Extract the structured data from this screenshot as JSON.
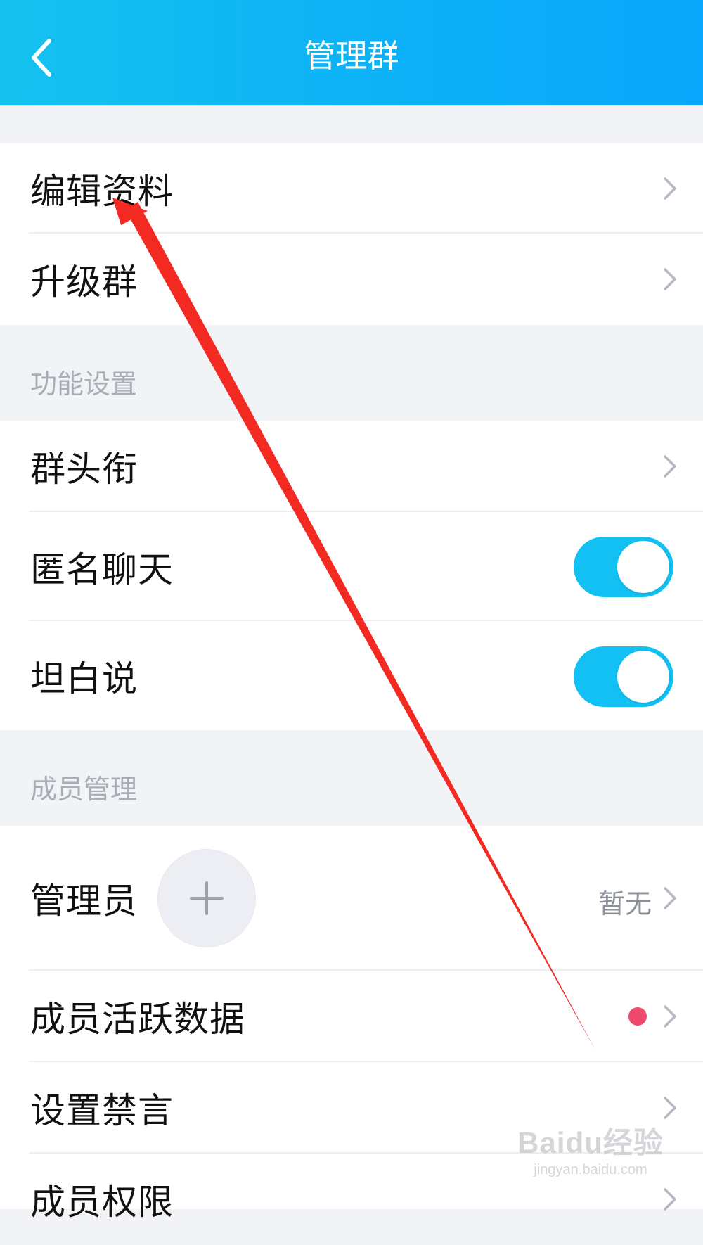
{
  "header": {
    "title": "管理群",
    "back_icon": "back-chevron-icon"
  },
  "group_top": {
    "items": [
      {
        "label": "编辑资料"
      },
      {
        "label": "升级群"
      }
    ]
  },
  "section_function": {
    "title": "功能设置",
    "items": [
      {
        "label": "群头衔"
      },
      {
        "label": "匿名聊天",
        "toggle": true
      },
      {
        "label": "坦白说",
        "toggle": true
      }
    ]
  },
  "section_members": {
    "title": "成员管理",
    "items": [
      {
        "label": "管理员",
        "value": "暂无",
        "add_icon": "plus-icon"
      },
      {
        "label": "成员活跃数据",
        "badge": "red-dot"
      },
      {
        "label": "设置禁言"
      },
      {
        "label": "成员权限"
      }
    ]
  },
  "colors": {
    "header": "#0db1f6",
    "toggle_on": "#12c0f4",
    "badge": "#f1496b",
    "annotation_arrow": "#f22a22"
  },
  "watermark": {
    "brand": "Baidu经验",
    "url": "jingyan.baidu.com"
  }
}
